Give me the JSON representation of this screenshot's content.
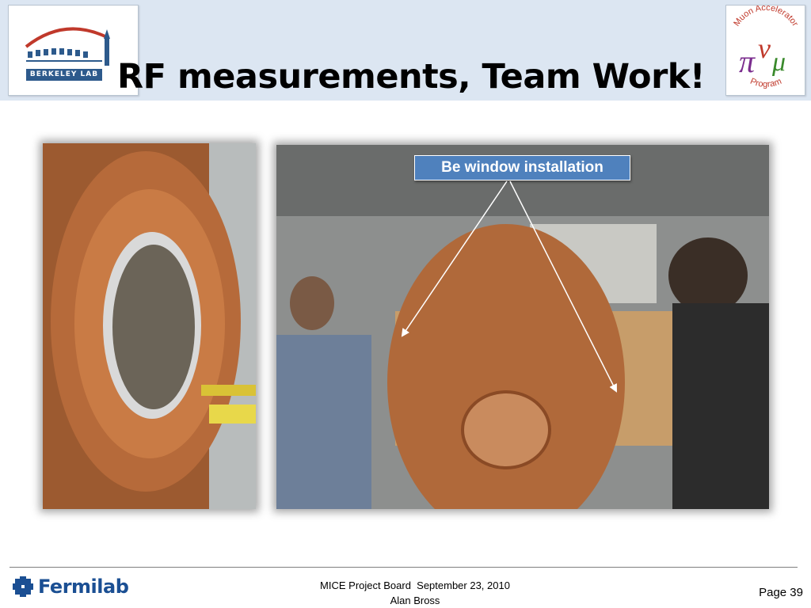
{
  "slide": {
    "title": "RF measurements, Team Work!",
    "callout": "Be window installation"
  },
  "logos": {
    "berkeley": {
      "name": "Berkeley Lab",
      "text": "BERKELEY LAB"
    },
    "muon": {
      "name": "Muon Accelerator Program",
      "text_top": "Muon Accelerator",
      "text_bottom": "Program"
    },
    "fermilab": {
      "name": "Fermilab",
      "text": "Fermilab"
    }
  },
  "images": {
    "left": "Copper RF cavity with Be window",
    "right": "Team installing Be window on copper RF cavity"
  },
  "footer": {
    "line1": "MICE Project Board  September 23, 2010",
    "line2": "Alan Bross",
    "page": "Page 39"
  },
  "colors": {
    "header_band": "#dce6f2",
    "callout_bg": "#4f81bd",
    "fermilab_blue": "#1b4f93"
  }
}
